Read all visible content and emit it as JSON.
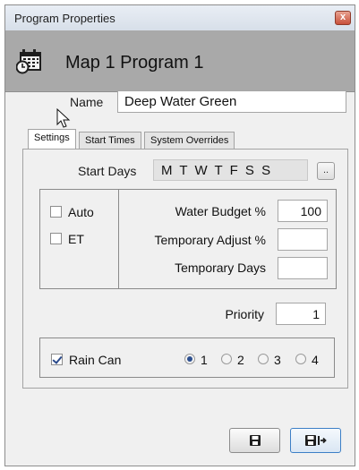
{
  "window": {
    "title": "Program Properties",
    "close_glyph": "x",
    "header_title": "Map 1 Program 1",
    "header_icon": "calendar-clock-icon"
  },
  "name": {
    "label": "Name",
    "value": "Deep Water Green"
  },
  "tabs": [
    {
      "label": "Settings",
      "active": true
    },
    {
      "label": "Start Times",
      "active": false
    },
    {
      "label": "System Overrides",
      "active": false
    }
  ],
  "settings": {
    "start_days_label": "Start Days",
    "start_days_value": "M T W T F S S",
    "start_days_button": "..",
    "auto_label": "Auto",
    "auto_checked": false,
    "et_label": "ET",
    "et_checked": false,
    "water_budget_label": "Water Budget %",
    "water_budget_value": "100",
    "temp_adjust_label": "Temporary Adjust %",
    "temp_adjust_value": "",
    "temp_days_label": "Temporary Days",
    "temp_days_value": "",
    "priority_label": "Priority",
    "priority_value": "1",
    "rain_can_label": "Rain Can",
    "rain_can_checked": true,
    "rain_can_options": [
      "1",
      "2",
      "3",
      "4"
    ],
    "rain_can_selected": "1"
  },
  "buttons": {
    "save_icon": "save-icon",
    "save_close_icon": "save-and-close-icon"
  },
  "colors": {
    "header_bg": "#a9a9a9",
    "window_bg": "#f0f0f0",
    "accent": "#3c7fc6"
  }
}
